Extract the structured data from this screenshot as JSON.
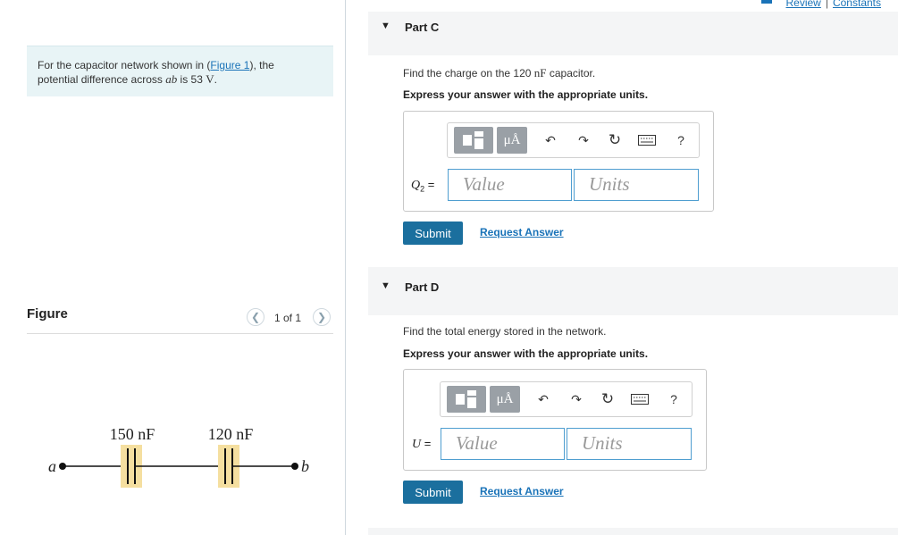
{
  "top_links": {
    "review": "Review",
    "separator": "|",
    "constants": "Constants"
  },
  "problem": {
    "text_prefix": "For the capacitor network shown in (",
    "figure_link": "Figure 1",
    "text_middle": "), the",
    "text_line2_prefix": "potential difference across ",
    "ab": "ab",
    "text_is": " is 53 ",
    "unit": "V",
    "period": "."
  },
  "figure": {
    "title": "Figure",
    "pager": "1 of 1",
    "labels": {
      "c1": "150 nF",
      "c2": "120 nF",
      "a": "a",
      "b": "b"
    }
  },
  "toolbar": {
    "units_symbol": "μÅ",
    "help": "?"
  },
  "parts": [
    {
      "title": "Part C",
      "question_prefix": "Find the charge on the 120 ",
      "question_unit": "nF",
      "question_suffix": " capacitor.",
      "express": "Express your answer with the appropriate units.",
      "var": "Q",
      "var_sub": "2",
      "equals": "=",
      "value_placeholder": "Value",
      "units_placeholder": "Units",
      "submit": "Submit",
      "request": "Request Answer"
    },
    {
      "title": "Part D",
      "question": "Find the total energy stored in the network.",
      "express": "Express your answer with the appropriate units.",
      "var": "U",
      "equals": "=",
      "value_placeholder": "Value",
      "units_placeholder": "Units",
      "submit": "Submit",
      "request": "Request Answer"
    }
  ],
  "colors": {
    "accent": "#1a73b8",
    "submit": "#1b6f9e",
    "problem_bg": "#e8f4f6",
    "capacitor_plate_bg": "#f5dfa0"
  }
}
